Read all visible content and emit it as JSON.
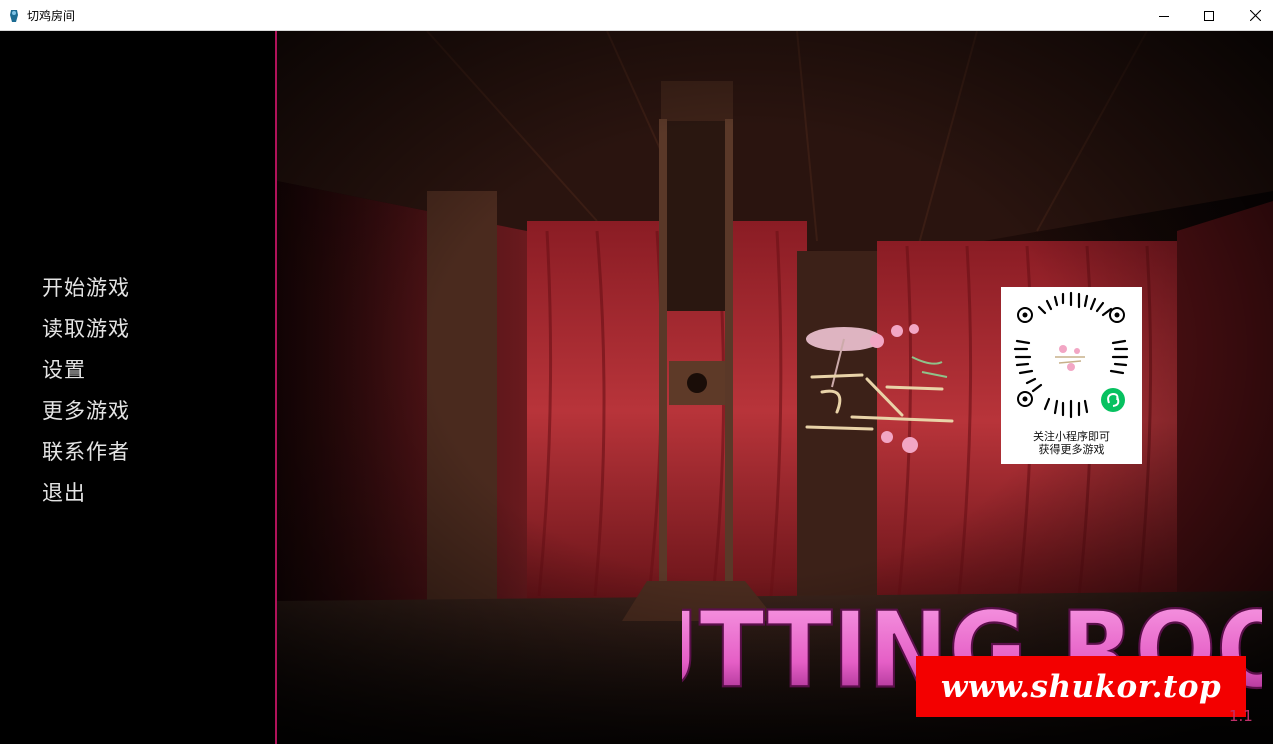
{
  "window": {
    "title": "切鸡房间",
    "controls": [
      "minimize",
      "maximize",
      "close"
    ]
  },
  "menu": {
    "items": [
      {
        "label": "开始游戏"
      },
      {
        "label": "读取游戏"
      },
      {
        "label": "设置"
      },
      {
        "label": "更多游戏"
      },
      {
        "label": "联系作者"
      },
      {
        "label": "退出"
      }
    ]
  },
  "qr_card": {
    "caption_line1": "关注小程序即可",
    "caption_line2": "获得更多游戏"
  },
  "title_art": {
    "text": "CUTTING ROOM"
  },
  "watermark": {
    "text": "www.shukor.top"
  },
  "version": "1.1",
  "colors": {
    "accent": "#b0125a",
    "title_pink": "#f06bd0",
    "watermark_red": "#f30000",
    "curtain_red": "#a8262e"
  }
}
